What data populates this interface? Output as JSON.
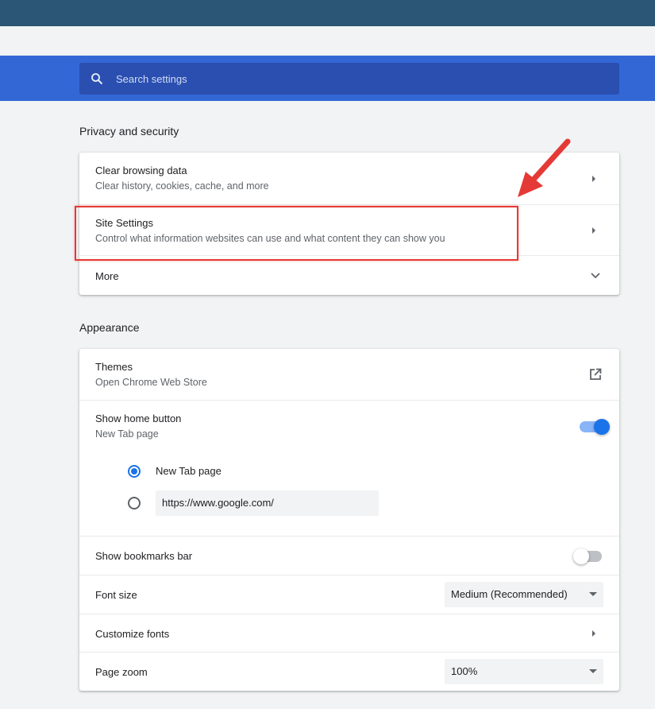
{
  "search": {
    "placeholder": "Search settings"
  },
  "privacy": {
    "title": "Privacy and security",
    "items": [
      {
        "label": "Clear browsing data",
        "sub": "Clear history, cookies, cache, and more"
      },
      {
        "label": "Site Settings",
        "sub": "Control what information websites can use and what content they can show you"
      },
      {
        "label": "More"
      }
    ]
  },
  "appearance": {
    "title": "Appearance",
    "themes": {
      "label": "Themes",
      "sub": "Open Chrome Web Store"
    },
    "home_button": {
      "label": "Show home button",
      "sub": "New Tab page",
      "enabled": true,
      "options": [
        {
          "label": "New Tab page",
          "checked": true
        },
        {
          "value": "https://www.google.com/",
          "checked": false
        }
      ]
    },
    "bookmarks_bar": {
      "label": "Show bookmarks bar",
      "enabled": false
    },
    "font_size": {
      "label": "Font size",
      "value": "Medium (Recommended)"
    },
    "customize_fonts": {
      "label": "Customize fonts"
    },
    "page_zoom": {
      "label": "Page zoom",
      "value": "100%"
    }
  },
  "colors": {
    "accent": "#1a73e8",
    "header": "#3367d6",
    "annotation": "#e53935"
  },
  "icons": [
    "search-icon",
    "chevron-right-icon",
    "chevron-down-icon",
    "external-link-icon"
  ]
}
